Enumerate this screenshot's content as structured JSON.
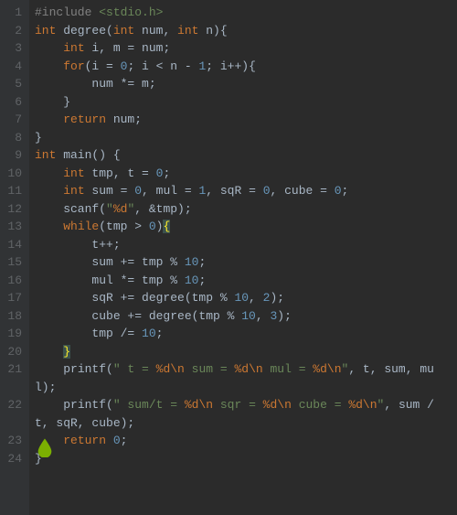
{
  "lines": [
    "1",
    "2",
    "3",
    "4",
    "5",
    "6",
    "7",
    "8",
    "9",
    "10",
    "11",
    "12",
    "13",
    "14",
    "15",
    "16",
    "17",
    "18",
    "19",
    "20",
    "21",
    "22",
    "23",
    "24"
  ],
  "code": {
    "l1_pre": "#include ",
    "l1_inc": "<stdio.h>",
    "l2_kw1": "int",
    "l2_fn": " degree(",
    "l2_kw2": "int",
    "l2_a": " num, ",
    "l2_kw3": "int",
    "l2_b": " n){",
    "l3_sp": "    ",
    "l3_kw": "int",
    "l3_txt": " i, m = num;",
    "l4_sp": "    ",
    "l4_kw": "for",
    "l4_a": "(i = ",
    "l4_n0": "0",
    "l4_b": "; i < n - ",
    "l4_n1": "1",
    "l4_c": "; i++){",
    "l5": "        num *= m;",
    "l6": "    }",
    "l7_sp": "    ",
    "l7_kw": "return",
    "l7_txt": " num;",
    "l8": "}",
    "l9_kw": "int",
    "l9_txt": " main() {",
    "l10_sp": "    ",
    "l10_kw": "int",
    "l10_a": " tmp, t = ",
    "l10_n": "0",
    "l10_b": ";",
    "l11_sp": "    ",
    "l11_kw": "int",
    "l11_a": " sum = ",
    "l11_n0": "0",
    "l11_b": ", mul = ",
    "l11_n1": "1",
    "l11_c": ", sqR = ",
    "l11_n2": "0",
    "l11_d": ", cube = ",
    "l11_n3": "0",
    "l11_e": ";",
    "l12_sp": "    scanf(",
    "l12_s1": "\"",
    "l12_fmt": "%d",
    "l12_s2": "\"",
    "l12_b": ", &tmp);",
    "l13_sp": "    ",
    "l13_kw": "while",
    "l13_a": "(tmp > ",
    "l13_n": "0",
    "l13_b": ")",
    "l13_br": "{",
    "l14": "        t++;",
    "l15_a": "        sum += tmp % ",
    "l15_n": "10",
    "l15_b": ";",
    "l16_a": "        mul *= tmp % ",
    "l16_n": "10",
    "l16_b": ";",
    "l17_a": "        sqR += degree(tmp % ",
    "l17_n1": "10",
    "l17_b": ", ",
    "l17_n2": "2",
    "l17_c": ");",
    "l18_a": "        cube += degree(tmp % ",
    "l18_n1": "10",
    "l18_b": ", ",
    "l18_n2": "3",
    "l18_c": ");",
    "l19_a": "        tmp /= ",
    "l19_n": "10",
    "l19_b": ";",
    "l20_sp": "    ",
    "l20_br": "}",
    "l21_sp": "    printf(",
    "l21_s1": "\" t = ",
    "l21_f1": "%d\\n",
    "l21_s2": " sum = ",
    "l21_f2": "%d\\n",
    "l21_s3": " mul = ",
    "l21_f3": "%d\\n",
    "l21_s4": "\"",
    "l21_b": ", t, sum, mul);",
    "l22_sp": "    printf(",
    "l22_s1": "\" sum/t = ",
    "l22_f1": "%d\\n",
    "l22_s2": " sqr = ",
    "l22_f2": "%d\\n",
    "l22_s3": " cube = ",
    "l22_f3": "%d\\n",
    "l22_s4": "\"",
    "l22_b": ", sum / t, sqR, cube);",
    "l23_sp": "    ",
    "l23_kw": "return",
    "l23_a": " ",
    "l23_n": "0",
    "l23_b": ";",
    "l24": "}"
  }
}
